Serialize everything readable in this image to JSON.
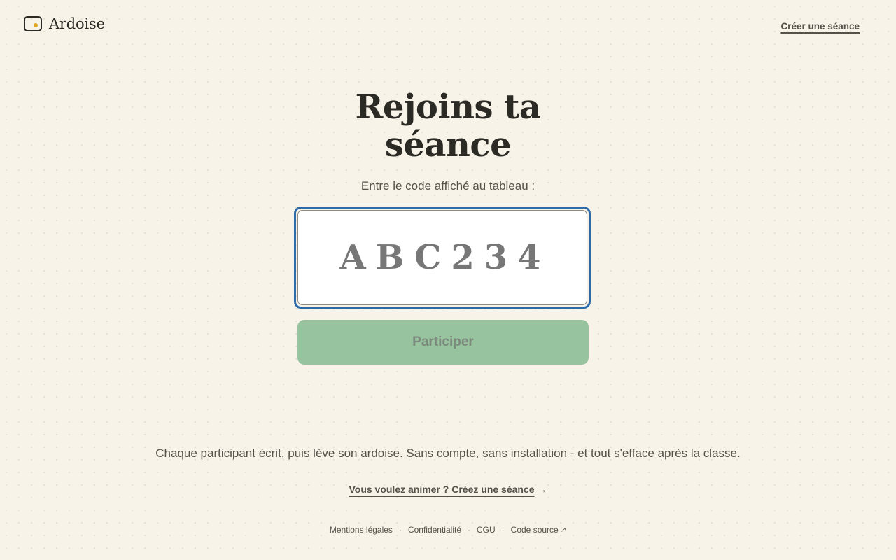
{
  "header": {
    "logo_text": "Ardoise",
    "create_session_link": "Créer une séance",
    "logo_accent_color": "#e0a526"
  },
  "main": {
    "title_line1": "Rejoins ta",
    "title_line2": "séance",
    "subtitle": "Entre le code affiché au tableau :",
    "code_input": {
      "placeholder": "ABC234",
      "value": ""
    },
    "join_button_label": "Participer",
    "join_button_state": "disabled"
  },
  "tagline": "Chaque participant écrit, puis lève son ardoise. Sans compte, sans installation - et tout s'efface après la classe.",
  "animate_link": {
    "label": "Vous voulez animer ? Créez une séance",
    "arrow_icon": "arrow-right-icon"
  },
  "footer": {
    "links": [
      "Mentions légales",
      "Confidentialité",
      "CGU",
      "Code source"
    ],
    "separator": "·",
    "external_icon": "external-link-icon"
  },
  "colors": {
    "background": "#f8f3e8",
    "focus_ring": "#2c6aa8",
    "button_green": "#97c39e"
  }
}
